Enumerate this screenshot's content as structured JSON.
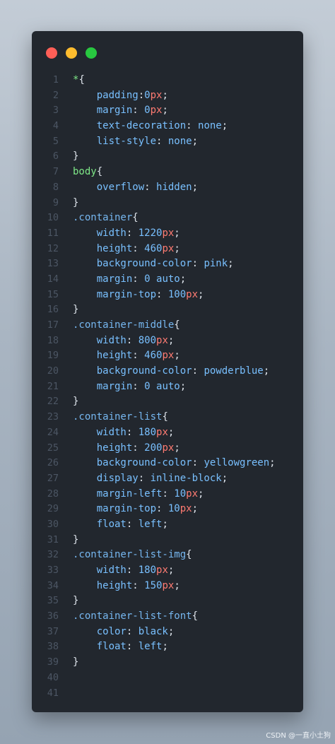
{
  "window": {
    "controls": [
      {
        "name": "close-button",
        "color": "#ff5f57"
      },
      {
        "name": "minimize-button",
        "color": "#febc2e"
      },
      {
        "name": "maximize-button",
        "color": "#28c840"
      }
    ]
  },
  "colors": {
    "default": "#dde3ea",
    "selector": "#76b7f0",
    "tag": "#7ee787",
    "property": "#79c0ff",
    "value": "#a5d6ff",
    "number": "#79c0ff",
    "unit": "#ff7b72",
    "keyword": "#79c0ff",
    "punct": "#dde3ea"
  },
  "editor": {
    "lines": [
      [
        {
          "t": "*",
          "c": "tag"
        },
        {
          "t": "{",
          "c": "punct"
        }
      ],
      [
        {
          "t": "    padding",
          "c": "property"
        },
        {
          "t": ":",
          "c": "punct"
        },
        {
          "t": "0",
          "c": "number"
        },
        {
          "t": "px",
          "c": "unit"
        },
        {
          "t": ";",
          "c": "punct"
        }
      ],
      [
        {
          "t": "    margin",
          "c": "property"
        },
        {
          "t": ": ",
          "c": "punct"
        },
        {
          "t": "0",
          "c": "number"
        },
        {
          "t": "px",
          "c": "unit"
        },
        {
          "t": ";",
          "c": "punct"
        }
      ],
      [
        {
          "t": "    text-decoration",
          "c": "property"
        },
        {
          "t": ": ",
          "c": "punct"
        },
        {
          "t": "none",
          "c": "keyword"
        },
        {
          "t": ";",
          "c": "punct"
        }
      ],
      [
        {
          "t": "    list-style",
          "c": "property"
        },
        {
          "t": ": ",
          "c": "punct"
        },
        {
          "t": "none",
          "c": "keyword"
        },
        {
          "t": ";",
          "c": "punct"
        }
      ],
      [
        {
          "t": "}",
          "c": "punct"
        }
      ],
      [
        {
          "t": "body",
          "c": "tag"
        },
        {
          "t": "{",
          "c": "punct"
        }
      ],
      [
        {
          "t": "    overflow",
          "c": "property"
        },
        {
          "t": ": ",
          "c": "punct"
        },
        {
          "t": "hidden",
          "c": "keyword"
        },
        {
          "t": ";",
          "c": "punct"
        }
      ],
      [
        {
          "t": "}",
          "c": "punct"
        }
      ],
      [
        {
          "t": ".container",
          "c": "selector"
        },
        {
          "t": "{",
          "c": "punct"
        }
      ],
      [
        {
          "t": "    width",
          "c": "property"
        },
        {
          "t": ": ",
          "c": "punct"
        },
        {
          "t": "1220",
          "c": "number"
        },
        {
          "t": "px",
          "c": "unit"
        },
        {
          "t": ";",
          "c": "punct"
        }
      ],
      [
        {
          "t": "    height",
          "c": "property"
        },
        {
          "t": ": ",
          "c": "punct"
        },
        {
          "t": "460",
          "c": "number"
        },
        {
          "t": "px",
          "c": "unit"
        },
        {
          "t": ";",
          "c": "punct"
        }
      ],
      [
        {
          "t": "    background-color",
          "c": "property"
        },
        {
          "t": ": ",
          "c": "punct"
        },
        {
          "t": "pink",
          "c": "keyword"
        },
        {
          "t": ";",
          "c": "punct"
        }
      ],
      [
        {
          "t": "    margin",
          "c": "property"
        },
        {
          "t": ": ",
          "c": "punct"
        },
        {
          "t": "0 auto",
          "c": "keyword"
        },
        {
          "t": ";",
          "c": "punct"
        }
      ],
      [
        {
          "t": "    margin-top",
          "c": "property"
        },
        {
          "t": ": ",
          "c": "punct"
        },
        {
          "t": "100",
          "c": "number"
        },
        {
          "t": "px",
          "c": "unit"
        },
        {
          "t": ";",
          "c": "punct"
        }
      ],
      [
        {
          "t": "}",
          "c": "punct"
        }
      ],
      [
        {
          "t": ".container-middle",
          "c": "selector"
        },
        {
          "t": "{",
          "c": "punct"
        }
      ],
      [
        {
          "t": "    width",
          "c": "property"
        },
        {
          "t": ": ",
          "c": "punct"
        },
        {
          "t": "800",
          "c": "number"
        },
        {
          "t": "px",
          "c": "unit"
        },
        {
          "t": ";",
          "c": "punct"
        }
      ],
      [
        {
          "t": "    height",
          "c": "property"
        },
        {
          "t": ": ",
          "c": "punct"
        },
        {
          "t": "460",
          "c": "number"
        },
        {
          "t": "px",
          "c": "unit"
        },
        {
          "t": ";",
          "c": "punct"
        }
      ],
      [
        {
          "t": "    background-color",
          "c": "property"
        },
        {
          "t": ": ",
          "c": "punct"
        },
        {
          "t": "powderblue",
          "c": "keyword"
        },
        {
          "t": ";",
          "c": "punct"
        }
      ],
      [
        {
          "t": "    margin",
          "c": "property"
        },
        {
          "t": ": ",
          "c": "punct"
        },
        {
          "t": "0 auto",
          "c": "keyword"
        },
        {
          "t": ";",
          "c": "punct"
        }
      ],
      [
        {
          "t": "}",
          "c": "punct"
        }
      ],
      [
        {
          "t": ".container-list",
          "c": "selector"
        },
        {
          "t": "{",
          "c": "punct"
        }
      ],
      [
        {
          "t": "    width",
          "c": "property"
        },
        {
          "t": ": ",
          "c": "punct"
        },
        {
          "t": "180",
          "c": "number"
        },
        {
          "t": "px",
          "c": "unit"
        },
        {
          "t": ";",
          "c": "punct"
        }
      ],
      [
        {
          "t": "    height",
          "c": "property"
        },
        {
          "t": ": ",
          "c": "punct"
        },
        {
          "t": "200",
          "c": "number"
        },
        {
          "t": "px",
          "c": "unit"
        },
        {
          "t": ";",
          "c": "punct"
        }
      ],
      [
        {
          "t": "    background-color",
          "c": "property"
        },
        {
          "t": ": ",
          "c": "punct"
        },
        {
          "t": "yellowgreen",
          "c": "keyword"
        },
        {
          "t": ";",
          "c": "punct"
        }
      ],
      [
        {
          "t": "    display",
          "c": "property"
        },
        {
          "t": ": ",
          "c": "punct"
        },
        {
          "t": "inline-block",
          "c": "keyword"
        },
        {
          "t": ";",
          "c": "punct"
        }
      ],
      [
        {
          "t": "    margin-left",
          "c": "property"
        },
        {
          "t": ": ",
          "c": "punct"
        },
        {
          "t": "10",
          "c": "number"
        },
        {
          "t": "px",
          "c": "unit"
        },
        {
          "t": ";",
          "c": "punct"
        }
      ],
      [
        {
          "t": "    margin-top",
          "c": "property"
        },
        {
          "t": ": ",
          "c": "punct"
        },
        {
          "t": "10",
          "c": "number"
        },
        {
          "t": "px",
          "c": "unit"
        },
        {
          "t": ";",
          "c": "punct"
        }
      ],
      [
        {
          "t": "    float",
          "c": "property"
        },
        {
          "t": ": ",
          "c": "punct"
        },
        {
          "t": "left",
          "c": "keyword"
        },
        {
          "t": ";",
          "c": "punct"
        }
      ],
      [
        {
          "t": "}",
          "c": "punct"
        }
      ],
      [
        {
          "t": ".container-list-img",
          "c": "selector"
        },
        {
          "t": "{",
          "c": "punct"
        }
      ],
      [
        {
          "t": "    width",
          "c": "property"
        },
        {
          "t": ": ",
          "c": "punct"
        },
        {
          "t": "180",
          "c": "number"
        },
        {
          "t": "px",
          "c": "unit"
        },
        {
          "t": ";",
          "c": "punct"
        }
      ],
      [
        {
          "t": "    height",
          "c": "property"
        },
        {
          "t": ": ",
          "c": "punct"
        },
        {
          "t": "150",
          "c": "number"
        },
        {
          "t": "px",
          "c": "unit"
        },
        {
          "t": ";",
          "c": "punct"
        }
      ],
      [
        {
          "t": "}",
          "c": "punct"
        }
      ],
      [
        {
          "t": ".container-list-font",
          "c": "selector"
        },
        {
          "t": "{",
          "c": "punct"
        }
      ],
      [
        {
          "t": "    color",
          "c": "property"
        },
        {
          "t": ": ",
          "c": "punct"
        },
        {
          "t": "black",
          "c": "keyword"
        },
        {
          "t": ";",
          "c": "punct"
        }
      ],
      [
        {
          "t": "    float",
          "c": "property"
        },
        {
          "t": ": ",
          "c": "punct"
        },
        {
          "t": "left",
          "c": "keyword"
        },
        {
          "t": ";",
          "c": "punct"
        }
      ],
      [
        {
          "t": "}",
          "c": "punct"
        }
      ],
      [],
      []
    ]
  },
  "watermark": "CSDN @一直小土狗"
}
